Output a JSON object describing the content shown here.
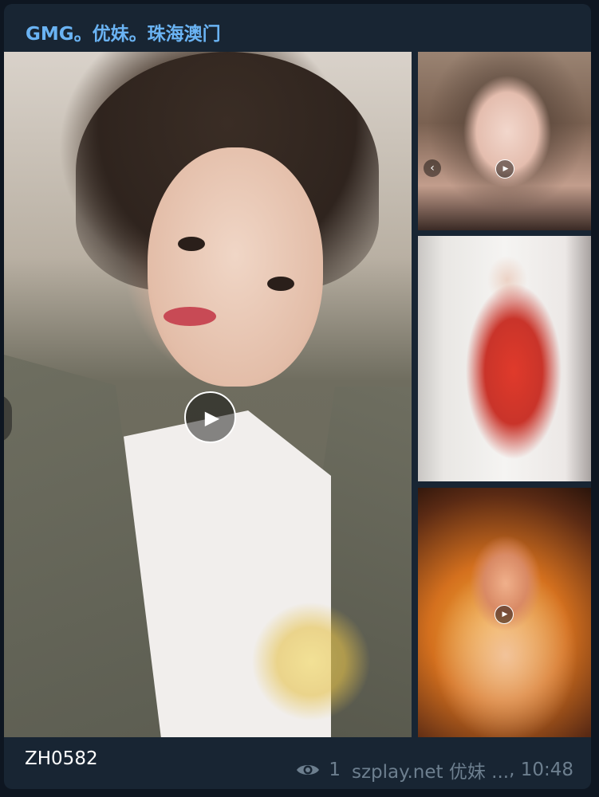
{
  "post": {
    "channel_title": "GMG。优妹。珠海澳门",
    "caption": "ZH0582",
    "views": "1",
    "author": "szplay.net 优妹 ...",
    "time": "10:48",
    "separator": ", "
  },
  "icons": {
    "play": "play-icon",
    "eye": "eye-icon",
    "prev": "chevron-left-icon"
  },
  "colors": {
    "channel_title": "#6ab3f3",
    "card_background": "#182533",
    "page_background": "#0e1621",
    "meta_text": "#6d7f8f"
  },
  "glyphs": {
    "play": "▶",
    "prev": "‹"
  }
}
